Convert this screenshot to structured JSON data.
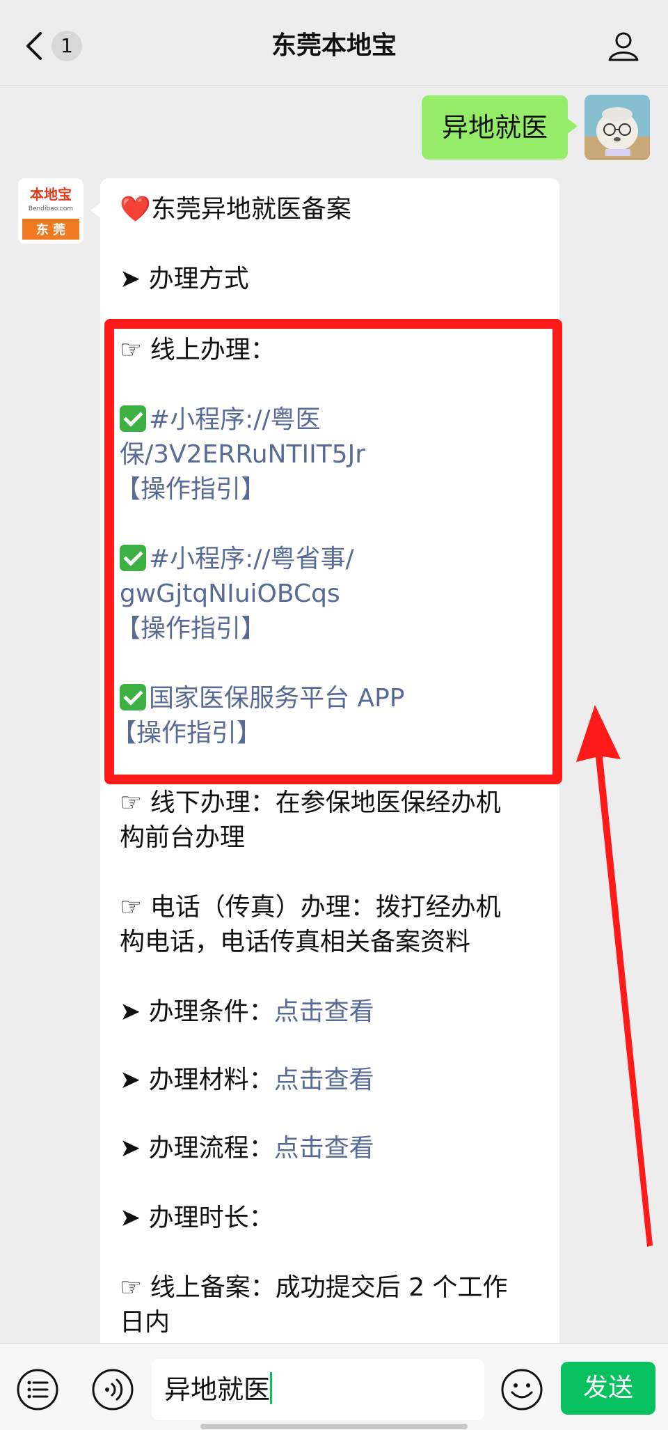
{
  "header": {
    "title": "东莞本地宝",
    "unread_count": "1"
  },
  "outgoing": {
    "text": "异地就医"
  },
  "avatar_brand": {
    "logo_text": "本地宝",
    "logo_domain": "Bendibao.com",
    "city_label": "东 莞"
  },
  "message": {
    "title_emoji": "❤️",
    "title": "东莞异地就医备案",
    "method_heading": "➤ 办理方式",
    "online_heading": "☞ 线上办理：",
    "online_items": [
      {
        "line1": "#小程序://粤医",
        "line2": "保/3V2ERRuNTIIT5Jr",
        "guide": "【操作指引】"
      },
      {
        "line1": "#小程序://粤省事/",
        "line2": "gwGjtqNIuiOBCqs",
        "guide": "【操作指引】"
      },
      {
        "line1": "国家医保服务平台 APP",
        "guide": "【操作指引】"
      }
    ],
    "offline": {
      "line1": "☞ 线下办理：在参保地医保经办机",
      "line2": "构前台办理"
    },
    "phone": {
      "line1": "☞ 电话（传真）办理：拨打经办机",
      "line2": "构电话，电话传真相关备案资料"
    },
    "conditions": {
      "label": "➤ 办理条件：",
      "link": "点击查看"
    },
    "materials": {
      "label": "➤ 办理材料：",
      "link": "点击查看"
    },
    "process": {
      "label": "➤ 办理流程：",
      "link": "点击查看"
    },
    "duration_heading": "➤ 办理时长：",
    "online_filing": {
      "line1": "☞ 线上备案：成功提交后 2 个工作",
      "line2": "日内"
    }
  },
  "input": {
    "value": "异地就医",
    "send_label": "发送"
  },
  "colors": {
    "background": "#ededed",
    "outgoing_bubble": "#95ec69",
    "link": "#576b95",
    "highlight": "#ff1a1a",
    "send_button": "#07c160"
  },
  "icons": [
    "back-icon",
    "profile-icon",
    "list-icon",
    "voice-icon",
    "emoji-icon",
    "check-icon",
    "red-arrow"
  ]
}
